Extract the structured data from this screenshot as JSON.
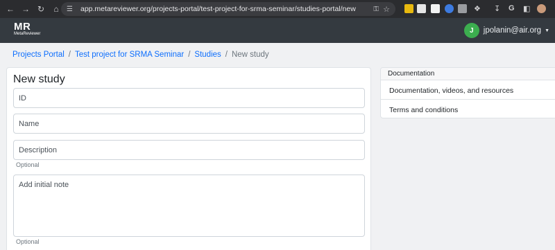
{
  "browser": {
    "url": "app.metareviewer.org/projects-portal/test-project-for-srma-seminar/studies-portal/new"
  },
  "app": {
    "logo_text": "MR",
    "logo_subtext": "MetaReviewer",
    "user": {
      "initial": "J",
      "email": "jpolanin@air.org"
    }
  },
  "breadcrumb": {
    "items": [
      "Projects Portal",
      "Test project for SRMA Seminar",
      "Studies"
    ],
    "current": "New study"
  },
  "form": {
    "title": "New study",
    "id_placeholder": "ID",
    "name_placeholder": "Name",
    "description_placeholder": "Description",
    "description_help": "Optional",
    "note_placeholder": "Add initial note",
    "note_help": "Optional"
  },
  "documentation": {
    "header": "Documentation",
    "items": [
      "Documentation, videos, and resources",
      "Terms and conditions"
    ]
  }
}
